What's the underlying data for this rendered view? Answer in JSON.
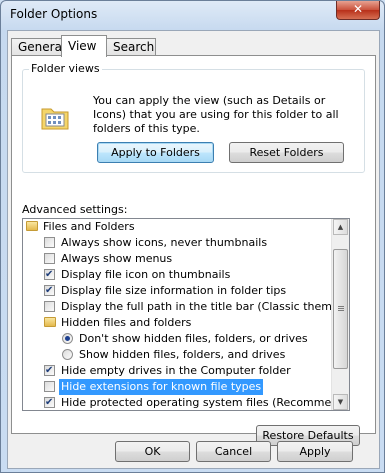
{
  "window": {
    "title": "Folder Options",
    "close_glyph": "✕"
  },
  "tabs": [
    {
      "label": "General"
    },
    {
      "label": "View"
    },
    {
      "label": "Search"
    }
  ],
  "folder_views": {
    "group_label": "Folder views",
    "description": "You can apply the view (such as Details or Icons) that you are using for this folder to all folders of this type.",
    "apply_button": "Apply to Folders",
    "reset_button": "Reset Folders"
  },
  "advanced": {
    "label": "Advanced settings:",
    "items": [
      {
        "type": "folder",
        "text": "Files and Folders"
      },
      {
        "type": "checkbox",
        "checked": false,
        "text": "Always show icons, never thumbnails"
      },
      {
        "type": "checkbox",
        "checked": false,
        "text": "Always show menus"
      },
      {
        "type": "checkbox",
        "checked": true,
        "text": "Display file icon on thumbnails"
      },
      {
        "type": "checkbox",
        "checked": true,
        "text": "Display file size information in folder tips"
      },
      {
        "type": "checkbox",
        "checked": false,
        "text": "Display the full path in the title bar (Classic theme only)"
      },
      {
        "type": "folder",
        "text": "Hidden files and folders"
      },
      {
        "type": "radio",
        "checked": true,
        "text": "Don't show hidden files, folders, or drives"
      },
      {
        "type": "radio",
        "checked": false,
        "text": "Show hidden files, folders, and drives"
      },
      {
        "type": "checkbox",
        "checked": true,
        "text": "Hide empty drives in the Computer folder"
      },
      {
        "type": "checkbox",
        "checked": false,
        "text": "Hide extensions for known file types",
        "selected": true
      },
      {
        "type": "checkbox",
        "checked": true,
        "text": "Hide protected operating system files (Recommended)"
      }
    ],
    "restore_button": "Restore Defaults"
  },
  "footer": {
    "ok": "OK",
    "cancel": "Cancel",
    "apply": "Apply"
  },
  "colors": {
    "selection": "#3399ff",
    "close_button": "#c9513b"
  }
}
